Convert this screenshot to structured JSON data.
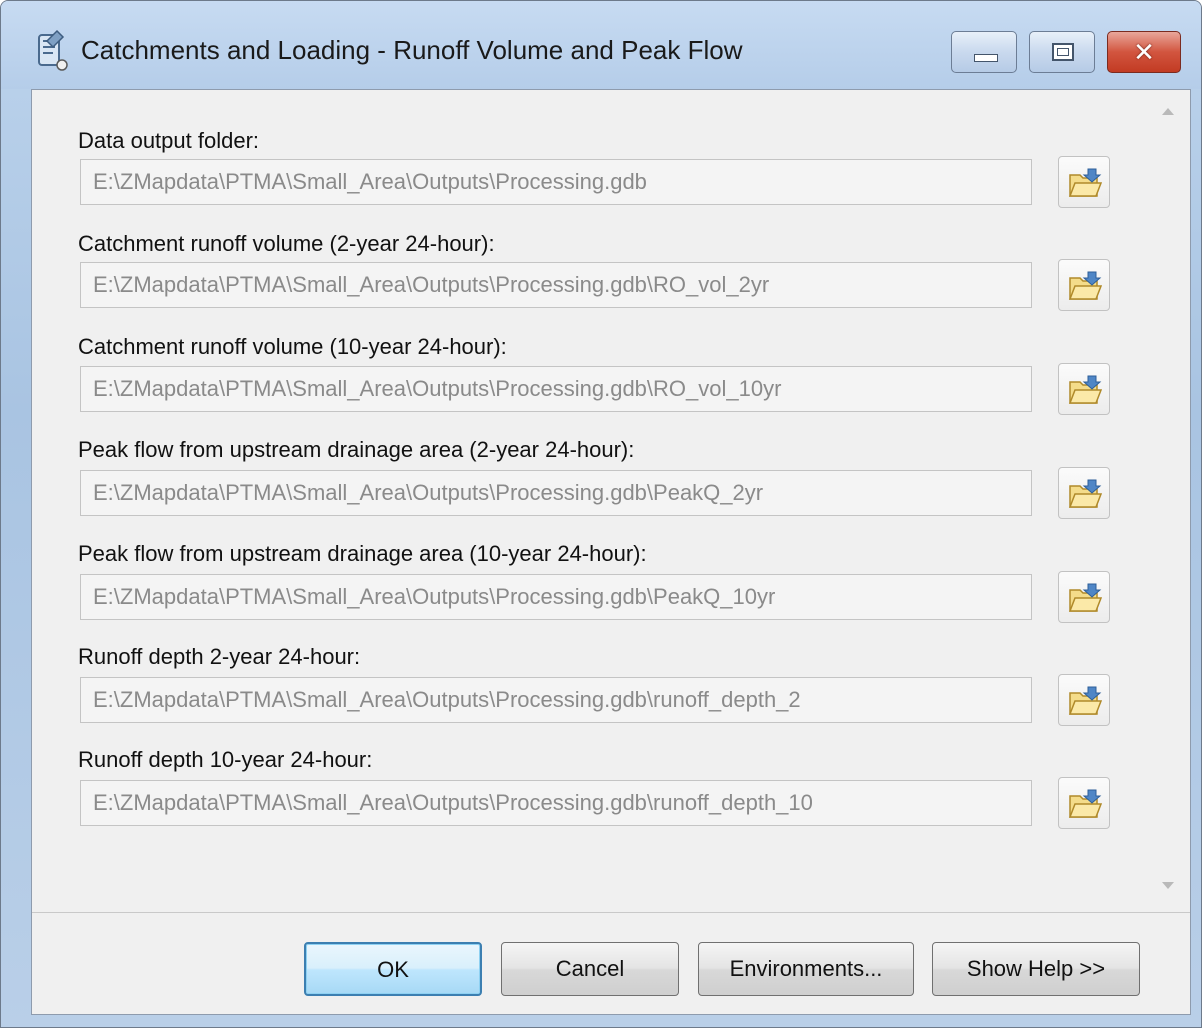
{
  "window": {
    "title": "Catchments and Loading - Runoff Volume and Peak Flow"
  },
  "fields": [
    {
      "label": "Data output folder:",
      "value": "E:\\ZMapdata\\PTMA\\Small_Area\\Outputs\\Processing.gdb"
    },
    {
      "label": "Catchment runoff volume (2-year 24-hour):",
      "value": "E:\\ZMapdata\\PTMA\\Small_Area\\Outputs\\Processing.gdb\\RO_vol_2yr"
    },
    {
      "label": "Catchment runoff volume (10-year 24-hour):",
      "value": "E:\\ZMapdata\\PTMA\\Small_Area\\Outputs\\Processing.gdb\\RO_vol_10yr"
    },
    {
      "label": "Peak flow from upstream drainage area (2-year 24-hour):",
      "value": "E:\\ZMapdata\\PTMA\\Small_Area\\Outputs\\Processing.gdb\\PeakQ_2yr"
    },
    {
      "label": "Peak flow from upstream drainage area (10-year 24-hour):",
      "value": "E:\\ZMapdata\\PTMA\\Small_Area\\Outputs\\Processing.gdb\\PeakQ_10yr"
    },
    {
      "label": "Runoff depth 2-year 24-hour:",
      "value": "E:\\ZMapdata\\PTMA\\Small_Area\\Outputs\\Processing.gdb\\runoff_depth_2"
    },
    {
      "label": "Runoff depth 10-year 24-hour:",
      "value": "E:\\ZMapdata\\PTMA\\Small_Area\\Outputs\\Processing.gdb\\runoff_depth_10"
    }
  ],
  "buttons": {
    "ok": "OK",
    "cancel": "Cancel",
    "environments": "Environments...",
    "show_help": "Show Help >>"
  },
  "icons": {
    "app": "toolbox-script-icon",
    "browse": "open-folder-icon",
    "minimize": "minimize-icon",
    "maximize": "maximize-icon",
    "close": "close-icon"
  },
  "colors": {
    "frame": "#b5cde9",
    "close_button": "#c23b23",
    "default_button_border": "#3c7fb1",
    "disabled_text": "#8a8a8a"
  }
}
